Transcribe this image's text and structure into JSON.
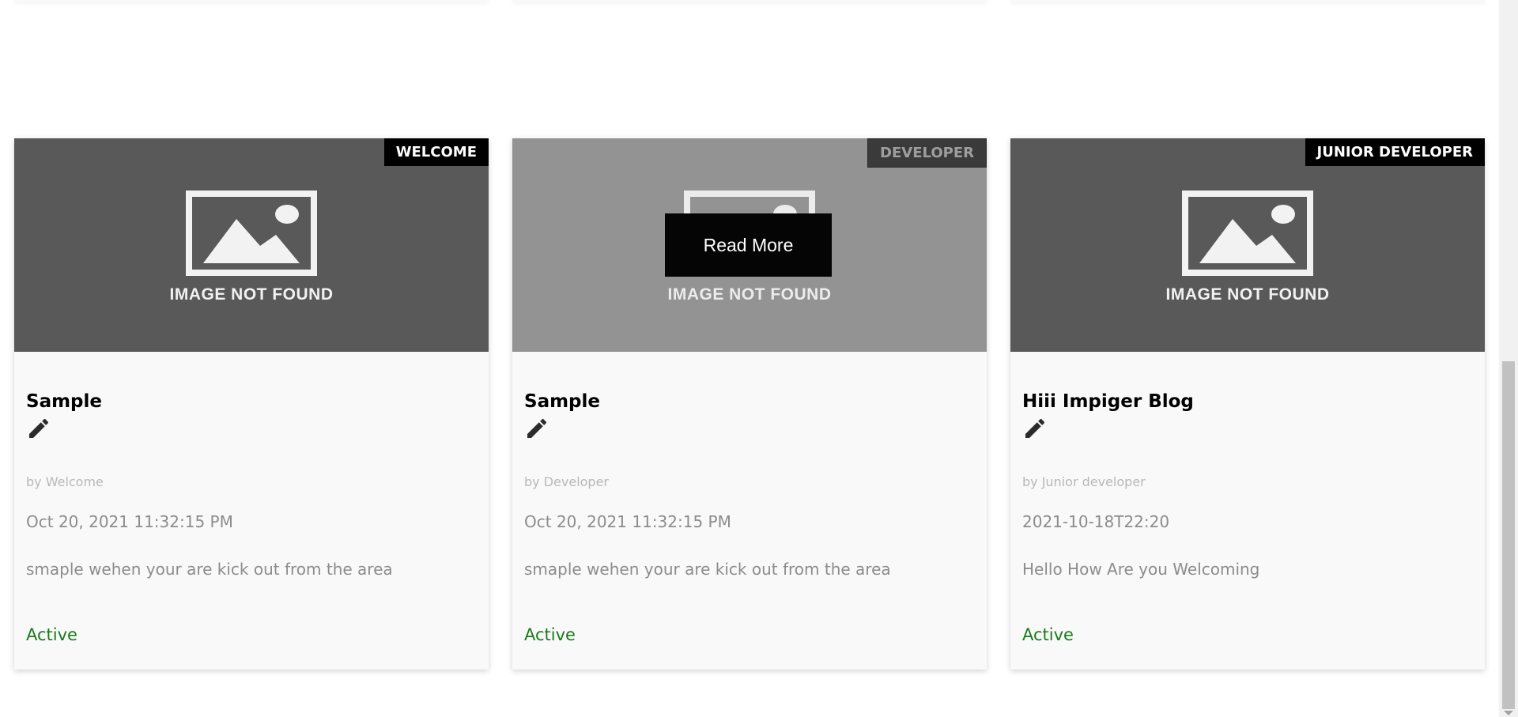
{
  "cards": [
    {
      "tag": "WELCOME",
      "image_text": "IMAGE NOT FOUND",
      "title": "Sample",
      "author": "by Welcome",
      "date": "Oct 20, 2021 11:32:15 PM",
      "description": "smaple wehen your are kick out from the area",
      "status": "Active"
    },
    {
      "tag": "DEVELOPER",
      "image_text": "IMAGE NOT FOUND",
      "read_more": "Read More",
      "title": "Sample",
      "author": "by Developer",
      "date": "Oct 20, 2021 11:32:15 PM",
      "description": "smaple wehen your are kick out from the area",
      "status": "Active"
    },
    {
      "tag": "JUNIOR DEVELOPER",
      "image_text": "IMAGE NOT FOUND",
      "title": "Hiii Impiger Blog",
      "author": "by Junior developer",
      "date": "2021-10-18T22:20",
      "description": "Hello How Are you Welcoming",
      "status": "Active"
    }
  ],
  "colors": {
    "card_bg": "#f9f9f9",
    "media_bg": "#595959",
    "media_hover_bg": "#939393",
    "tag_bg": "#000000",
    "status_active": "#1a7a1a",
    "muted_text": "#8c8c8c"
  },
  "icons": {
    "edit": "pencil-icon",
    "placeholder": "image-placeholder-icon"
  }
}
